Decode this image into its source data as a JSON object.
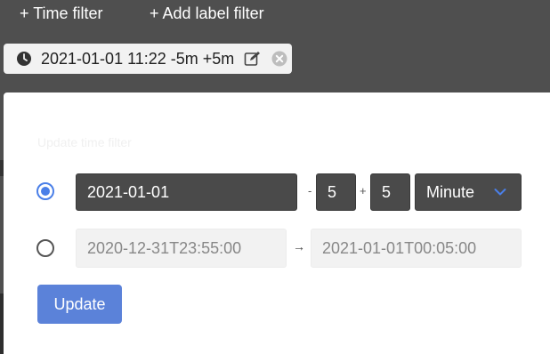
{
  "topbar": {
    "time_filter_label": "+ Time filter",
    "label_filter_label": "+ Add label filter"
  },
  "chip": {
    "text": "2021-01-01 11:22 -5m +5m",
    "icons": [
      "clock-icon",
      "edit-icon",
      "close-circle-icon"
    ]
  },
  "panel": {
    "title": "Update time filter",
    "date_value": "2021-01-01",
    "minus_sep": "-",
    "minus_value": "5",
    "plus_sep": "+",
    "plus_value": "5",
    "unit_selected": "Minute",
    "from_value": "2020-12-31T23:55:00",
    "arrow": "→",
    "to_value": "2021-01-01T00:05:00",
    "selected_mode": "relative",
    "update_label": "Update"
  },
  "colors": {
    "background": "#4f4f4f",
    "accent": "#4a7fe8",
    "button": "#5b82d9",
    "dark_input": "#4a4a4a"
  }
}
